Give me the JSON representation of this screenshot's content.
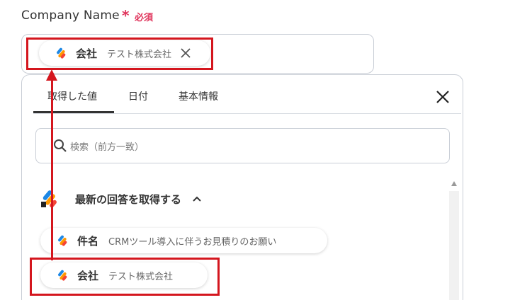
{
  "field": {
    "label": "Company Name",
    "required_star": "*",
    "required_text": "必須"
  },
  "selected_chip": {
    "key": "会社",
    "value": "テスト株式会社"
  },
  "panel": {
    "tabs": [
      {
        "label": "取得した値",
        "active": true
      },
      {
        "label": "日付",
        "active": false
      },
      {
        "label": "基本情報",
        "active": false
      }
    ],
    "search_placeholder": "検索（前方一致）",
    "section_title": "最新の回答を取得する",
    "items": [
      {
        "key": "件名",
        "value": "CRMツール導入に伴うお見積りのお願い"
      },
      {
        "key": "会社",
        "value": "テスト株式会社"
      }
    ]
  },
  "colors": {
    "required": "#e0365d",
    "highlight": "#d4161e",
    "icon_blue": "#1e88e5",
    "icon_orange": "#ff9800",
    "icon_red": "#f44336"
  },
  "icons": [
    "app-logo-icon",
    "close-icon",
    "search-icon",
    "chevron-up-icon"
  ]
}
